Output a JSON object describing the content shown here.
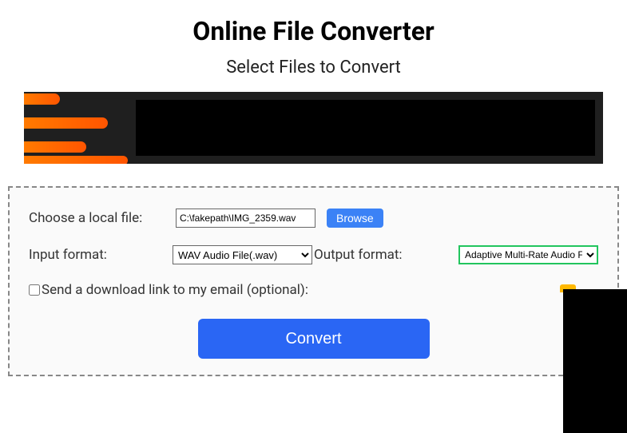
{
  "header": {
    "title": "Online File Converter",
    "subtitle": "Select Files to Convert"
  },
  "form": {
    "chooseFileLabel": "Choose a local file:",
    "filePathValue": "C:\\fakepath\\IMG_2359.wav",
    "browseLabel": "Browse",
    "inputFormatLabel": "Input format:",
    "inputFormatValue": "WAV Audio File(.wav)",
    "outputFormatLabel": "Output format:",
    "outputFormatValue": "Adaptive Multi-Rate Audio File(.amr)",
    "emailCheckboxLabel": "Send a download link to my email (optional):",
    "emailChecked": false,
    "convertLabel": "Convert"
  }
}
